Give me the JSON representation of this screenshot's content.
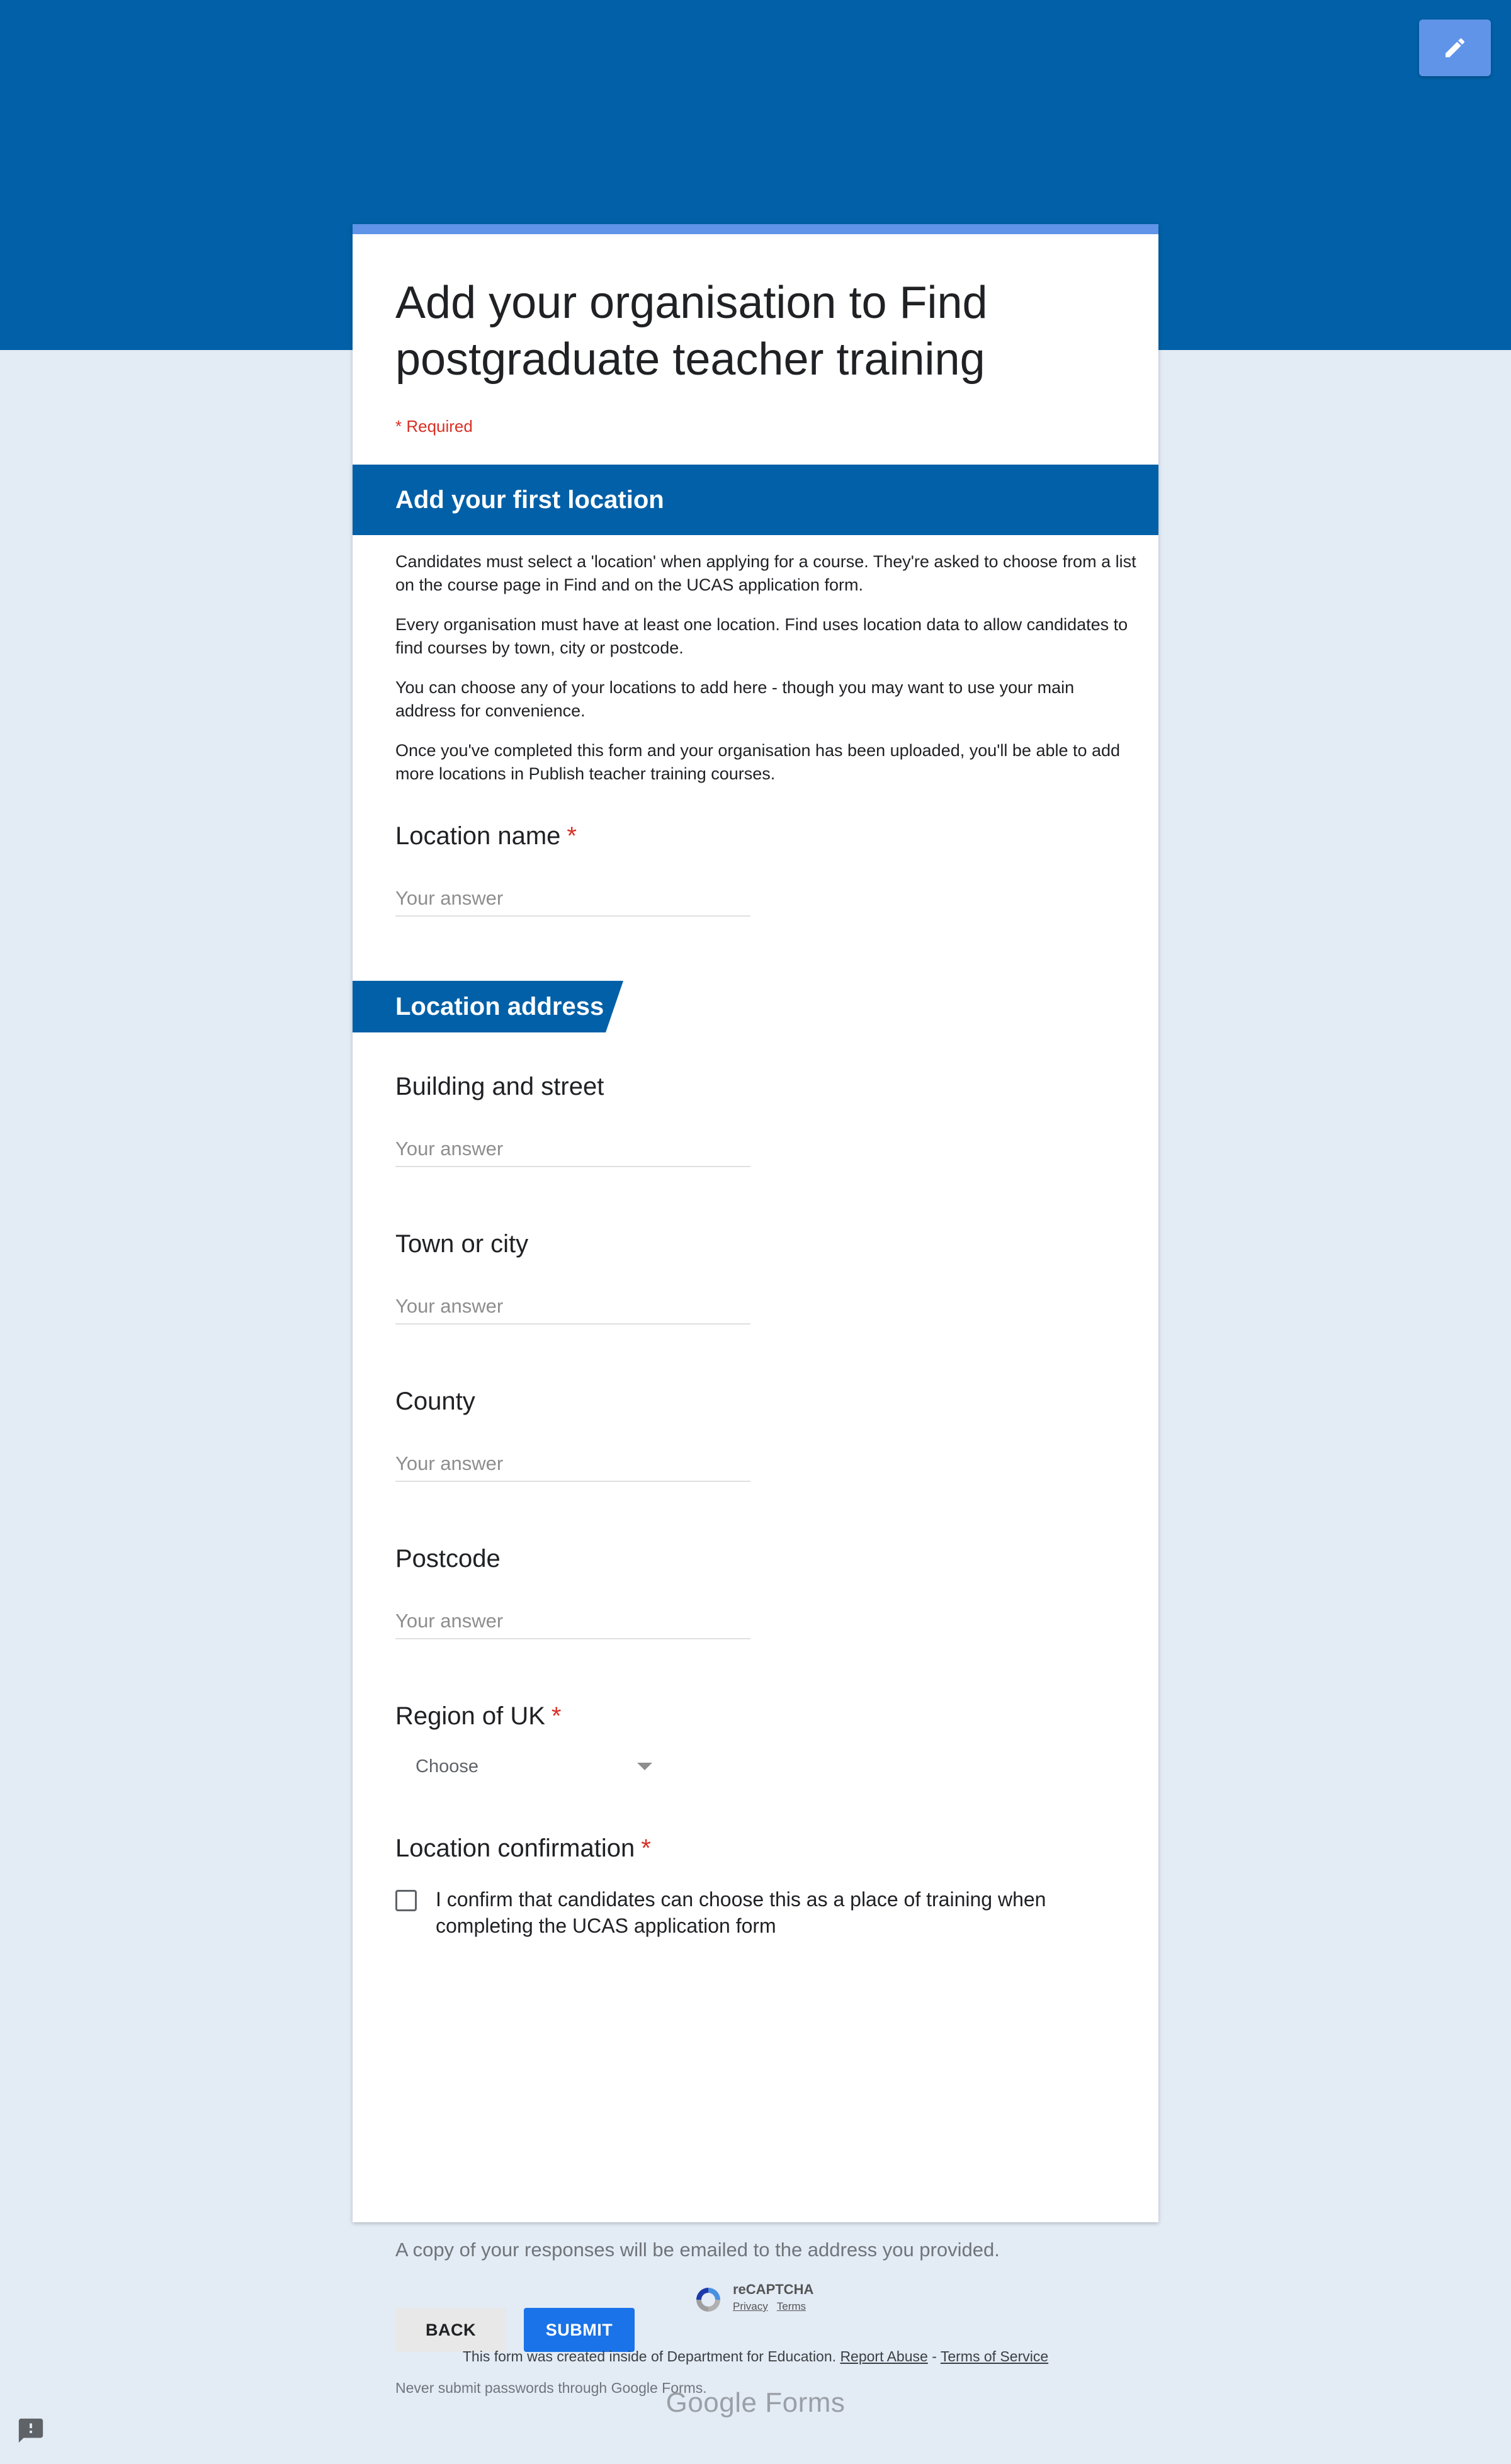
{
  "form": {
    "title": "Add your organisation to Find postgraduate teacher training",
    "required_note": "* Required"
  },
  "section": {
    "title": "Add your first location",
    "description": [
      "Candidates must select a 'location' when applying for a course. They're asked to choose from a list on the course page in Find and on the UCAS application form.",
      "Every organisation must have at least one location. Find uses location data to allow candidates to find courses by town, city or postcode.",
      "You can choose any of your locations to add here - though you may want to use your main address for convenience.",
      "Once you've completed this form and your organisation has been uploaded, you'll be able to add more locations in Publish teacher training courses."
    ]
  },
  "location_name": {
    "label": "Location name",
    "required_mark": "*",
    "placeholder": "Your answer"
  },
  "address_section": {
    "title": "Location address"
  },
  "building": {
    "label": "Building and street",
    "placeholder": "Your answer"
  },
  "town": {
    "label": "Town or city",
    "placeholder": "Your answer"
  },
  "county": {
    "label": "County",
    "placeholder": "Your answer"
  },
  "postcode": {
    "label": "Postcode",
    "placeholder": "Your answer"
  },
  "region": {
    "label": "Region of UK",
    "required_mark": "*",
    "selected": "Choose"
  },
  "confirmation": {
    "label": "Location confirmation",
    "required_mark": "*",
    "checkbox_label": "I confirm that candidates can choose this as a place of training when completing the UCAS application form"
  },
  "copy_note": "A copy of your responses will be emailed to the address you provided.",
  "buttons": {
    "back": "BACK",
    "submit": "SUBMIT"
  },
  "never_note": "Never submit passwords through Google Forms.",
  "recaptcha": {
    "title": "reCAPTCHA",
    "privacy": "Privacy",
    "terms": "Terms"
  },
  "footer": {
    "created_text": "This form was created inside of Department for Education.",
    "report_abuse": "Report Abuse",
    "separator": "-",
    "terms_of_service": "Terms of Service",
    "brand_google": "Google",
    "brand_forms": "Forms"
  },
  "colors": {
    "banner": "#0160a7",
    "accent": "#5f94e8",
    "submit": "#1a73e8",
    "required": "#d93025"
  },
  "icons": {
    "edit": "pencil-icon",
    "feedback": "feedback-icon",
    "dropdown": "chevron-down-icon",
    "recaptcha": "recaptcha-logo-icon"
  }
}
